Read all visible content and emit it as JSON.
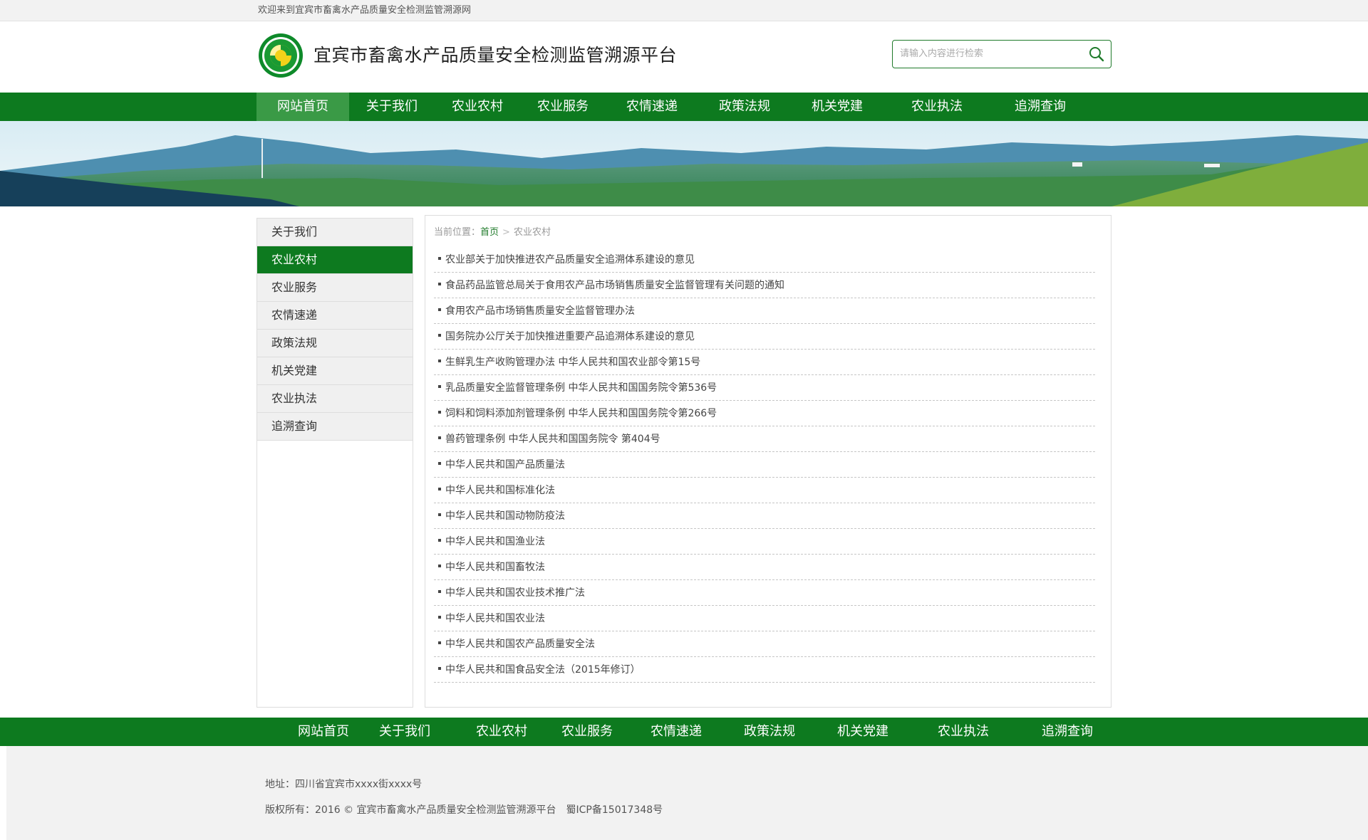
{
  "topbar": {
    "welcome": "欢迎来到宜宾市畜禽水产品质量安全检测监管溯源网"
  },
  "header": {
    "title": "宜宾市畜禽水产品质量安全检测监管溯源平台",
    "search_placeholder": "请输入内容进行检索"
  },
  "nav": {
    "items": [
      {
        "label": "网站首页",
        "active": true
      },
      {
        "label": "关于我们"
      },
      {
        "label": "农业农村"
      },
      {
        "label": "农业服务"
      },
      {
        "label": "农情速递"
      },
      {
        "label": "政策法规"
      },
      {
        "label": "机关党建"
      },
      {
        "label": "农业执法"
      },
      {
        "label": "追溯查询"
      }
    ]
  },
  "sidebar": {
    "items": [
      {
        "label": "关于我们"
      },
      {
        "label": "农业农村",
        "active": true
      },
      {
        "label": "农业服务"
      },
      {
        "label": "农情速递"
      },
      {
        "label": "政策法规"
      },
      {
        "label": "机关党建"
      },
      {
        "label": "农业执法"
      },
      {
        "label": "追溯查询"
      }
    ]
  },
  "breadcrumb": {
    "prefix": "当前位置：",
    "home": "首页",
    "separator": ">",
    "current": "农业农村"
  },
  "articles": [
    "农业部关于加快推进农产品质量安全追溯体系建设的意见",
    "食品药品监管总局关于食用农产品市场销售质量安全监督管理有关问题的通知",
    "食用农产品市场销售质量安全监督管理办法",
    "国务院办公厅关于加快推进重要产品追溯体系建设的意见",
    "生鲜乳生产收购管理办法 中华人民共和国农业部令第15号",
    "乳品质量安全监督管理条例 中华人民共和国国务院令第536号",
    "饲料和饲料添加剂管理条例 中华人民共和国国务院令第266号",
    "兽药管理条例 中华人民共和国国务院令 第404号",
    "中华人民共和国产品质量法",
    "中华人民共和国标准化法",
    "中华人民共和国动物防疫法",
    "中华人民共和国渔业法",
    "中华人民共和国畜牧法",
    "中华人民共和国农业技术推广法",
    "中华人民共和国农业法",
    "中华人民共和国农产品质量安全法",
    "中华人民共和国食品安全法（2015年修订）"
  ],
  "footer_nav": {
    "items": [
      "网站首页",
      "关于我们",
      "农业农村",
      "农业服务",
      "农情速递",
      "政策法规",
      "机关党建",
      "农业执法",
      "追溯查询"
    ]
  },
  "footer": {
    "address": "地址：四川省宜宾市xxxx街xxxx号",
    "copyright": "版权所有：2016 © 宜宾市畜禽水产品质量安全检测监管溯源平台",
    "icp": "蜀ICP备15017348号"
  },
  "colors": {
    "brand_green": "#0d7a1f",
    "nav_active": "#3a9a46",
    "logo_yellow": "#f2d21a"
  },
  "icons": {
    "search": "search-icon",
    "logo": "logo-emblem-icon"
  }
}
